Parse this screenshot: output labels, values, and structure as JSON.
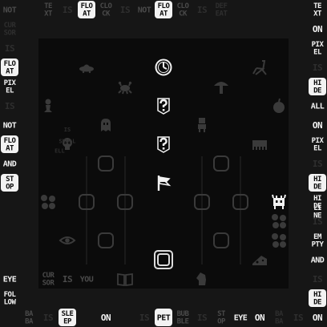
{
  "meta": {
    "title_words": [
      "BABA",
      "IS",
      "YOU"
    ]
  },
  "palette": {
    "background": "#161616",
    "board": "#0b0b0b",
    "text_bright": "#f2f2f2",
    "text_dim": "#4a4a4a",
    "text_dark": "#2e2e2e",
    "object_dim": "#3a3a3a"
  },
  "text_blocks": [
    {
      "lines": [
        "NOT"
      ],
      "c": 0,
      "r": 0,
      "style": "dim"
    },
    {
      "lines": [
        "TE",
        "XT"
      ],
      "c": 2,
      "r": 0,
      "style": "dim"
    },
    {
      "lines": [
        "IS"
      ],
      "c": 3,
      "r": 0,
      "style": "dark"
    },
    {
      "lines": [
        "FLO",
        "AT"
      ],
      "c": 4,
      "r": 0,
      "style": "inv"
    },
    {
      "lines": [
        "CLO",
        "CK"
      ],
      "c": 5,
      "r": 0,
      "style": "dim"
    },
    {
      "lines": [
        "IS"
      ],
      "c": 6,
      "r": 0,
      "style": "dark"
    },
    {
      "lines": [
        "NOT"
      ],
      "c": 7,
      "r": 0,
      "style": "dim"
    },
    {
      "lines": [
        "FLO",
        "AT"
      ],
      "c": 8,
      "r": 0,
      "style": "inv"
    },
    {
      "lines": [
        "CLO",
        "CK"
      ],
      "c": 9,
      "r": 0,
      "style": "dim"
    },
    {
      "lines": [
        "IS"
      ],
      "c": 10,
      "r": 0,
      "style": "dark"
    },
    {
      "lines": [
        "DEF",
        "EAT"
      ],
      "c": 11,
      "r": 0,
      "style": "dark"
    },
    {
      "lines": [
        "TE",
        "XT"
      ],
      "c": 16,
      "r": 0,
      "style": "bright"
    },
    {
      "lines": [
        "CUR",
        "SOR"
      ],
      "c": 0,
      "r": 1,
      "style": "dark"
    },
    {
      "lines": [
        "ON"
      ],
      "c": 16,
      "r": 1,
      "style": "bright"
    },
    {
      "lines": [
        "IS"
      ],
      "c": 0,
      "r": 2,
      "style": "dark"
    },
    {
      "lines": [
        "PIX",
        "EL"
      ],
      "c": 16,
      "r": 2,
      "style": "bright"
    },
    {
      "lines": [
        "FLO",
        "AT"
      ],
      "c": 0,
      "r": 3,
      "style": "inv"
    },
    {
      "lines": [
        "IS"
      ],
      "c": 16,
      "r": 3,
      "style": "dark"
    },
    {
      "lines": [
        "PIX",
        "EL"
      ],
      "c": 0,
      "r": 4,
      "style": "bright"
    },
    {
      "lines": [
        "HI",
        "DE"
      ],
      "c": 16,
      "r": 4,
      "style": "inv"
    },
    {
      "lines": [
        "IS"
      ],
      "c": 0,
      "r": 5,
      "style": "dark"
    },
    {
      "lines": [
        "ALL"
      ],
      "c": 16,
      "r": 5,
      "style": "bright"
    },
    {
      "lines": [
        "NOT"
      ],
      "c": 0,
      "r": 6,
      "style": "bright"
    },
    {
      "lines": [
        "ON"
      ],
      "c": 16,
      "r": 6,
      "style": "bright"
    },
    {
      "lines": [
        "FLO",
        "AT"
      ],
      "c": 0,
      "r": 7,
      "style": "inv"
    },
    {
      "lines": [
        "PIX",
        "EL"
      ],
      "c": 16,
      "r": 7,
      "style": "bright"
    },
    {
      "lines": [
        "AND"
      ],
      "c": 0,
      "r": 8,
      "style": "bright"
    },
    {
      "lines": [
        "IS"
      ],
      "c": 16,
      "r": 8,
      "style": "dark"
    },
    {
      "lines": [
        "ST",
        "OP"
      ],
      "c": 0,
      "r": 9,
      "style": "inv"
    },
    {
      "lines": [
        "HI",
        "DE"
      ],
      "c": 16,
      "r": 9,
      "style": "inv"
    },
    {
      "lines": [
        "HI",
        "DE"
      ],
      "c": 16,
      "r": 10,
      "style": "bright"
    },
    {
      "lines": [
        "LI",
        "NE"
      ],
      "c": 16,
      "r": 10,
      "style": "bright",
      "half": true
    },
    {
      "lines": [
        "IS"
      ],
      "c": 16,
      "r": 11,
      "style": "dark"
    },
    {
      "lines": [
        "EM",
        "PTY"
      ],
      "c": 16,
      "r": 12,
      "style": "bright"
    },
    {
      "lines": [
        "AND"
      ],
      "c": 16,
      "r": 13,
      "style": "bright"
    },
    {
      "lines": [
        "EYE"
      ],
      "c": 0,
      "r": 14,
      "style": "bright"
    },
    {
      "lines": [
        "CUR",
        "SOR"
      ],
      "c": 2,
      "r": 14,
      "style": "dim"
    },
    {
      "lines": [
        "IS"
      ],
      "c": 3,
      "r": 14,
      "style": "dim"
    },
    {
      "lines": [
        "YOU"
      ],
      "c": 4,
      "r": 14,
      "style": "dim"
    },
    {
      "lines": [
        "IS"
      ],
      "c": 16,
      "r": 14,
      "style": "dark"
    },
    {
      "lines": [
        "FOL",
        "LOW"
      ],
      "c": 0,
      "r": 15,
      "style": "bright"
    },
    {
      "lines": [
        "HI",
        "DE"
      ],
      "c": 16,
      "r": 15,
      "style": "inv"
    },
    {
      "lines": [
        "BA",
        "BA"
      ],
      "c": 1,
      "r": 16,
      "style": "dim"
    },
    {
      "lines": [
        "IS"
      ],
      "c": 2,
      "r": 16,
      "style": "dark"
    },
    {
      "lines": [
        "SLE",
        "EP"
      ],
      "c": 3,
      "r": 16,
      "style": "inv"
    },
    {
      "lines": [
        "ON"
      ],
      "c": 5,
      "r": 16,
      "style": "bright"
    },
    {
      "lines": [
        "IS"
      ],
      "c": 7,
      "r": 16,
      "style": "dark"
    },
    {
      "lines": [
        "PET"
      ],
      "c": 8,
      "r": 16,
      "style": "inv"
    },
    {
      "lines": [
        "BUB",
        "BLE"
      ],
      "c": 9,
      "r": 16,
      "style": "dim"
    },
    {
      "lines": [
        "IS"
      ],
      "c": 10,
      "r": 16,
      "style": "dark"
    },
    {
      "lines": [
        "ST",
        "OP"
      ],
      "c": 11,
      "r": 16,
      "style": "dim"
    },
    {
      "lines": [
        "EYE"
      ],
      "c": 12,
      "r": 16,
      "style": "bright"
    },
    {
      "lines": [
        "ON"
      ],
      "c": 13,
      "r": 16,
      "style": "bright"
    },
    {
      "lines": [
        "BA",
        "BA"
      ],
      "c": 14,
      "r": 16,
      "style": "dark"
    },
    {
      "lines": [
        "IS"
      ],
      "c": 15,
      "r": 16,
      "style": "dark"
    },
    {
      "lines": [
        "ON"
      ],
      "c": 16,
      "r": 16,
      "style": "bright"
    }
  ],
  "board_texts": [
    {
      "lines": [
        "IS"
      ],
      "c": 3,
      "r": 6.5,
      "style": "dark"
    },
    {
      "lines": [
        "SKULL"
      ],
      "c": 3,
      "r": 7.1,
      "style": "dark"
    },
    {
      "lines": [
        "ELL"
      ],
      "c": 2.6,
      "r": 7.6,
      "style": "dark"
    }
  ],
  "objects": [
    {
      "icon": "ufo-icon",
      "glyph": "ufo",
      "c": 4,
      "r": 3,
      "style": "dim"
    },
    {
      "icon": "clock-icon",
      "glyph": "clock",
      "c": 8,
      "r": 3,
      "style": "bright"
    },
    {
      "icon": "chair-icon",
      "glyph": "chair",
      "c": 13,
      "r": 3,
      "style": "dim"
    },
    {
      "icon": "crab-icon",
      "glyph": "crab",
      "c": 6,
      "r": 4,
      "style": "dim"
    },
    {
      "icon": "mushroom-icon",
      "glyph": "mushroom",
      "c": 11,
      "r": 4,
      "style": "dim"
    },
    {
      "icon": "pawn-icon",
      "glyph": "pawn",
      "c": 2,
      "r": 5,
      "style": "dim"
    },
    {
      "icon": "question-icon",
      "glyph": "question",
      "c": 8,
      "r": 5,
      "style": "bright"
    },
    {
      "icon": "apple-icon",
      "glyph": "apple",
      "c": 14,
      "r": 5,
      "style": "dim"
    },
    {
      "icon": "ghost-icon",
      "glyph": "ghost",
      "c": 5,
      "r": 6,
      "style": "dim"
    },
    {
      "icon": "robot-icon",
      "glyph": "robot",
      "c": 10,
      "r": 6,
      "style": "dim"
    },
    {
      "icon": "skull-icon",
      "glyph": "skull",
      "c": 3,
      "r": 7,
      "style": "dim"
    },
    {
      "icon": "question-icon",
      "glyph": "question",
      "c": 8,
      "r": 7,
      "style": "bright"
    },
    {
      "icon": "cart-icon",
      "glyph": "cart",
      "c": 13,
      "r": 7,
      "style": "dim"
    },
    {
      "icon": "flag-icon",
      "glyph": "flag",
      "c": 8,
      "r": 9,
      "style": "bright"
    },
    {
      "icon": "eye-icon",
      "glyph": "eye",
      "c": 3,
      "r": 12,
      "style": "dim"
    },
    {
      "icon": "cheese-icon",
      "glyph": "cheese",
      "c": 13,
      "r": 13,
      "style": "dim"
    },
    {
      "icon": "book-icon",
      "glyph": "book",
      "c": 6,
      "r": 14,
      "style": "dim"
    },
    {
      "icon": "knight-icon",
      "glyph": "knight",
      "c": 10,
      "r": 14,
      "style": "dim"
    },
    {
      "icon": "keke-icon",
      "glyph": "keke",
      "c": 14,
      "r": 10,
      "style": "bright"
    },
    {
      "icon": "rock-icon",
      "glyph": "rock",
      "c": 0,
      "r": 9,
      "style": "dim"
    },
    {
      "icon": "rock-icon",
      "glyph": "rock",
      "c": 2,
      "r": 10,
      "style": "dim"
    },
    {
      "icon": "rock-icon",
      "glyph": "rock",
      "c": 14,
      "r": 11,
      "style": "dim"
    },
    {
      "icon": "rock-icon",
      "glyph": "rock",
      "c": 14,
      "r": 12,
      "style": "dim"
    }
  ],
  "tiles": [
    {
      "c": 5,
      "r": 8
    },
    {
      "c": 11,
      "r": 8
    },
    {
      "c": 4,
      "r": 10
    },
    {
      "c": 6,
      "r": 10
    },
    {
      "c": 10,
      "r": 10
    },
    {
      "c": 12,
      "r": 10
    },
    {
      "c": 5,
      "r": 12
    },
    {
      "c": 11,
      "r": 12
    }
  ],
  "cursor": {
    "c": 8,
    "r": 13
  }
}
